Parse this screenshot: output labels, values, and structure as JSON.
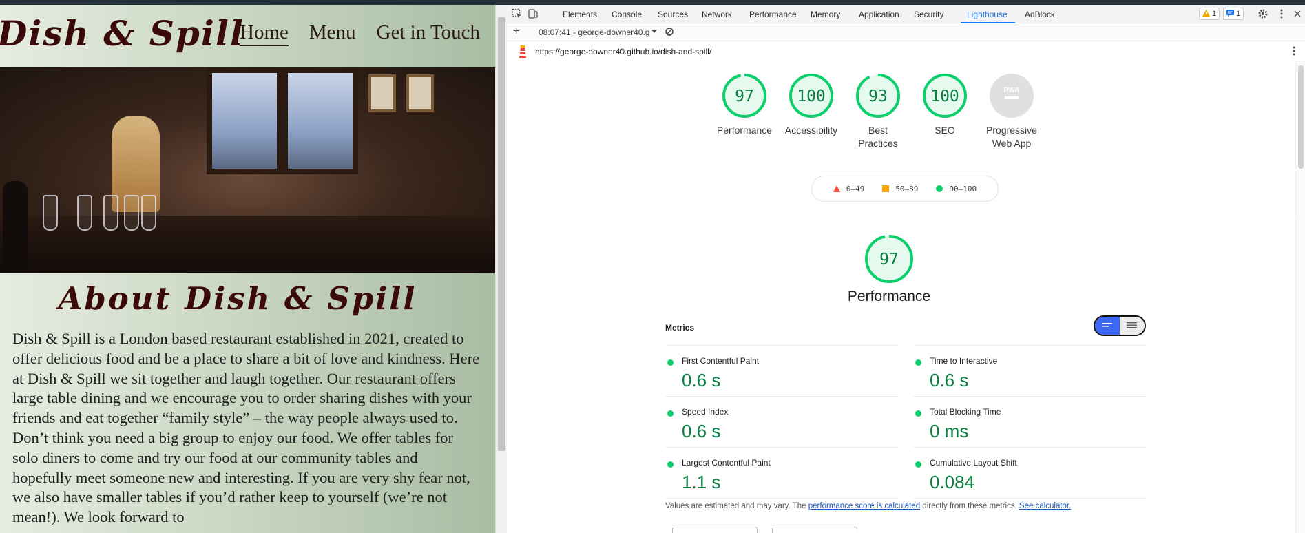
{
  "site": {
    "logo": "Dish & Spill",
    "nav": [
      "Home",
      "Menu",
      "Get in Touch"
    ],
    "about_title": "About Dish & Spill",
    "about_text": "Dish & Spill is a London based restaurant established in 2021, created to offer delicious food and be a place to share a bit of love and kindness. Here at Dish & Spill we sit together and laugh together. Our restaurant offers large table dining and we encourage you to order sharing dishes with your friends and eat together “family style” – the way people always used to. Don’t think you need a big group to enjoy our food. We offer tables for solo diners to come and try our food at our community tables and hopefully meet someone new and interesting. If you are very shy fear not, we also have smaller tables if you’d rather keep to yourself (we’re not mean!). We look forward to"
  },
  "devtools": {
    "tabs": [
      "Elements",
      "Console",
      "Sources",
      "Network",
      "Performance",
      "Memory",
      "Application",
      "Security",
      "Lighthouse",
      "AdBlock"
    ],
    "active_tab": "Lighthouse",
    "warnings_count": "1",
    "messages_count": "1",
    "report_selector": "08:07:41 - george-downer40.g",
    "url": "https://george-downer40.github.io/dish-and-spill/"
  },
  "lighthouse": {
    "scores": [
      {
        "label": "Performance",
        "value": "97",
        "score": 97
      },
      {
        "label": "Accessibility",
        "value": "100",
        "score": 100
      },
      {
        "label": "Best Practices",
        "value": "93",
        "score": 93
      },
      {
        "label": "SEO",
        "value": "100",
        "score": 100
      },
      {
        "label": "Progressive Web App",
        "value": "PWA",
        "score": null
      }
    ],
    "legend": [
      "0–49",
      "50–89",
      "90–100"
    ],
    "performance_title": "Performance",
    "performance_score": "97",
    "metrics_heading": "Metrics",
    "metrics": [
      {
        "name": "First Contentful Paint",
        "value": "0.6 s"
      },
      {
        "name": "Time to Interactive",
        "value": "0.6 s"
      },
      {
        "name": "Speed Index",
        "value": "0.6 s"
      },
      {
        "name": "Total Blocking Time",
        "value": "0 ms"
      },
      {
        "name": "Largest Contentful Paint",
        "value": "1.1 s"
      },
      {
        "name": "Cumulative Layout Shift",
        "value": "0.084"
      }
    ],
    "note_prefix": "Values are estimated and may vary. The ",
    "note_link1": "performance score is calculated",
    "note_mid": " directly from these metrics. ",
    "note_link2": "See calculator.",
    "colors": {
      "pass": "#0cce6b",
      "pass_text": "#0b8043",
      "average": "#ffa400",
      "fail": "#ff4e42"
    }
  }
}
